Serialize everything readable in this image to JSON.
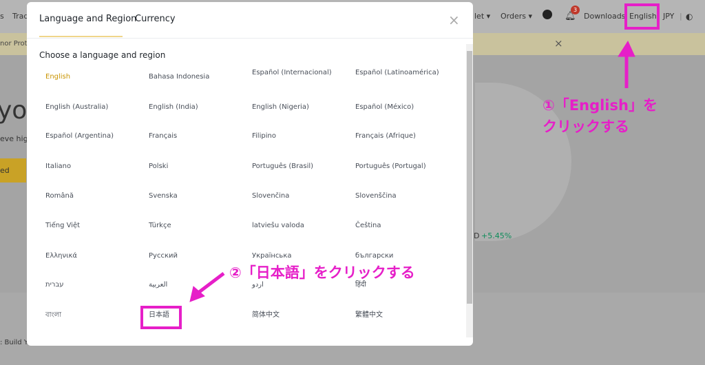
{
  "nav": {
    "left_items": [
      "s",
      "Trad"
    ],
    "wallet": "let ▾",
    "orders": "Orders ▾",
    "notification_count": "3",
    "downloads": "Downloads",
    "language": "English",
    "currency": "JPY"
  },
  "banner": {
    "text": "nor Proto",
    "close": "×"
  },
  "background": {
    "hero_title": "yo",
    "hero_sub": "eve high",
    "hero_button": "ed",
    "ticker": "D",
    "ticker_change": "+5.45%",
    "news": ": Build Yo..."
  },
  "modal": {
    "tabs": [
      {
        "label": "Language and Region",
        "active": true
      },
      {
        "label": "Currency",
        "active": false
      }
    ],
    "close": "×",
    "heading": "Choose a language and region",
    "languages": [
      [
        "English",
        "Bahasa Indonesia",
        "Español (Internacional)",
        "Español (Latinoamérica)"
      ],
      [
        "English (Australia)",
        "English (India)",
        "English (Nigeria)",
        "Español (México)"
      ],
      [
        "Español (Argentina)",
        "Français",
        "Filipino",
        "Français (Afrique)"
      ],
      [
        "Italiano",
        "Polski",
        "Português (Brasil)",
        "Português (Portugal)"
      ],
      [
        "Română",
        "Svenska",
        "Slovenčina",
        "Slovenščina"
      ],
      [
        "Tiếng Việt",
        "Türkçe",
        "latviešu valoda",
        "Čeština"
      ],
      [
        "Ελληνικά",
        "Русский",
        "Українська",
        "български"
      ],
      [
        "עברית",
        "العربية",
        "اردو",
        "हिंदी"
      ],
      [
        "বাংলা",
        "日本語",
        "简体中文",
        "繁體中文"
      ]
    ],
    "selected": "English"
  },
  "annotations": {
    "step1_line1": "①「English」を",
    "step1_line2": "クリックする",
    "step2": "②「日本語」をクリックする",
    "color": "#e61fc8"
  },
  "colors": {
    "accent": "#f0b90b",
    "selected_text": "#c99400",
    "positive": "#0ecb81"
  }
}
